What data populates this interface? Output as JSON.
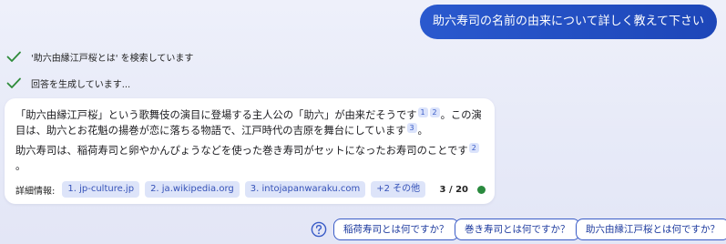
{
  "user_message": "助六寿司の名前の由来について詳しく教えて下さい",
  "status": {
    "searching": "'助六由縁江戸桜とは' を検索しています",
    "generating": "回答を生成しています..."
  },
  "answer": {
    "p1": {
      "a": "「助六由縁江戸桜」という歌舞伎の演目に登場する主人公の「助六」が由来だそうです",
      "c1": "1",
      "c2": "2",
      "b": "。この演目は、助六とお花魁の揚巻が恋に落ちる物語で、江戸時代の吉原を舞台にしています",
      "c3": "3",
      "c": "。"
    },
    "p2": {
      "a": "助六寿司は、稲荷寿司と卵やかんぴょうなどを使った巻き寿司がセットになったお寿司のことです",
      "c1": "2",
      "b": "。"
    }
  },
  "footer": {
    "label": "詳細情報:",
    "sources": [
      "1. jp-culture.jp",
      "2. ja.wikipedia.org",
      "3. intojapanwaraku.com"
    ],
    "more": "+2 その他",
    "counter": "3 / 20",
    "status_color": "#2a8a3e"
  },
  "suggestions": [
    "稲荷寿司とは何ですか？",
    "巻き寿司とは何ですか？",
    "助六由縁江戸桜とは何ですか？"
  ],
  "colors": {
    "accent": "#1d46b8",
    "check": "#2e8b3a",
    "chip_bg": "#dde4f9"
  },
  "icons": {
    "status": "check-icon",
    "help": "help-circle-icon"
  }
}
